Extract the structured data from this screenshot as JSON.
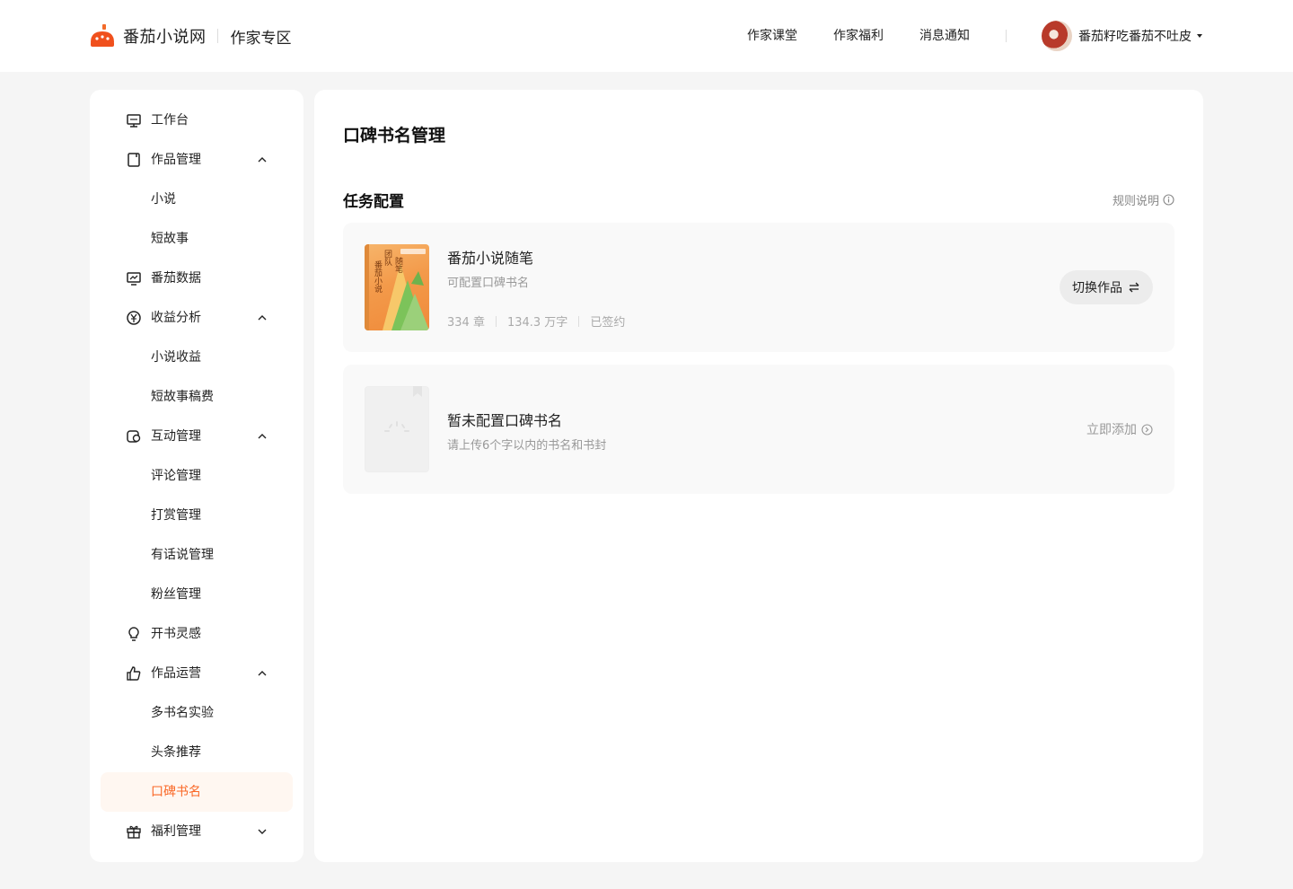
{
  "header": {
    "logo_text": "番茄小说网",
    "zone_text": "作家专区",
    "nav": [
      {
        "label": "作家课堂"
      },
      {
        "label": "作家福利"
      },
      {
        "label": "消息通知"
      }
    ],
    "user_name": "番茄籽吃番茄不吐皮"
  },
  "sidebar": {
    "items": [
      {
        "label": "工作台",
        "icon": "monitor-icon"
      },
      {
        "label": "作品管理",
        "icon": "book-icon",
        "expanded": true
      },
      {
        "label": "小说"
      },
      {
        "label": "短故事"
      },
      {
        "label": "番茄数据",
        "icon": "chart-icon"
      },
      {
        "label": "收益分析",
        "icon": "yen-icon",
        "expanded": true
      },
      {
        "label": "小说收益"
      },
      {
        "label": "短故事稿费"
      },
      {
        "label": "互动管理",
        "icon": "chat-icon",
        "expanded": true
      },
      {
        "label": "评论管理"
      },
      {
        "label": "打赏管理"
      },
      {
        "label": "有话说管理"
      },
      {
        "label": "粉丝管理"
      },
      {
        "label": "开书灵感",
        "icon": "bulb-icon"
      },
      {
        "label": "作品运营",
        "icon": "thumb-icon",
        "expanded": true
      },
      {
        "label": "多书名实验"
      },
      {
        "label": "头条推荐"
      },
      {
        "label": "口碑书名",
        "active": true
      },
      {
        "label": "福利管理",
        "icon": "gift-icon",
        "expanded": false
      }
    ]
  },
  "main": {
    "page_title": "口碑书名管理",
    "section_title": "任务配置",
    "rules_label": "规则说明",
    "book": {
      "title": "番茄小说随笔",
      "subtitle": "可配置口碑书名",
      "chapters": "334 章",
      "words": "134.3 万字",
      "status": "已签约",
      "switch_label": "切换作品",
      "cover_text_1": "随笔",
      "cover_text_2": "团队",
      "cover_text_3": "番茄小说"
    },
    "empty": {
      "title": "暂未配置口碑书名",
      "subtitle": "请上传6个字以内的书名和书封",
      "add_label": "立即添加"
    }
  },
  "colors": {
    "accent": "#fa6725",
    "active_bg": "#fff7f1",
    "page_bg": "#f5f5f5"
  }
}
